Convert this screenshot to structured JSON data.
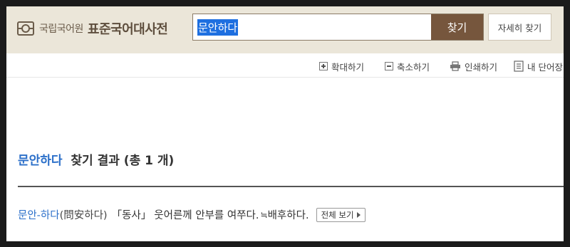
{
  "header": {
    "org_name": "국립국어원",
    "dict_name": "표준국어대사전",
    "search": {
      "value": "문안하다",
      "button_label": "찾기"
    },
    "detail_search_label": "자세히 찾기"
  },
  "toolbar": {
    "zoom_in": "확대하기",
    "zoom_out": "축소하기",
    "print": "인쇄하기",
    "my_vocab": "내 단어장"
  },
  "results": {
    "keyword": "문안하다",
    "summary": "찾기 결과 (총 1 개)",
    "entries": [
      {
        "word": "문안-하다",
        "hanja": "(問安하다)",
        "pos": "「동사」",
        "definition": "웃어른께 안부를 여쭈다.",
        "see_also_mark": "≒",
        "see_also": "배후하다.",
        "view_all_label": "전체 보기"
      }
    ]
  },
  "colors": {
    "header_bg": "#ebe6d9",
    "search_button": "#76563d",
    "link": "#2b6fc9"
  }
}
